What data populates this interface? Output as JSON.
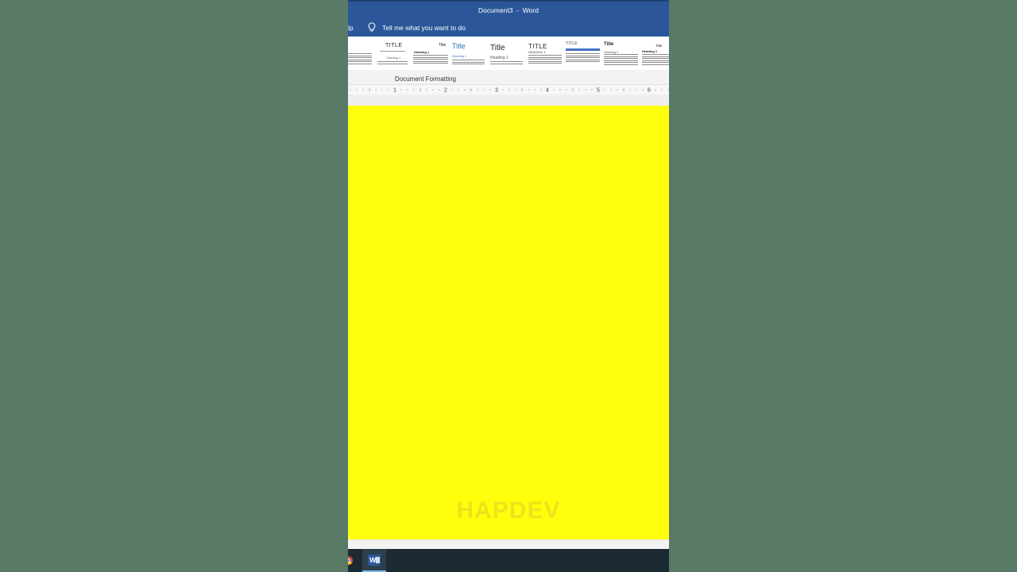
{
  "window": {
    "title": "Document3  -  Word"
  },
  "tell_bar": {
    "help_tab": "lp",
    "search_label": "Tell me what you want to do"
  },
  "ribbon": {
    "group_label": "Document Formatting",
    "gallery": [
      {
        "title": "",
        "heading": ""
      },
      {
        "title": "TITLE",
        "heading": "Heading 1"
      },
      {
        "title": "Title",
        "heading": "Heading 1"
      },
      {
        "title": "Title",
        "heading": "Heading 1"
      },
      {
        "title": "Title",
        "heading": "Heading 1"
      },
      {
        "title": "TITLE",
        "heading": "HEADING 1"
      },
      {
        "title": "TITLE",
        "heading": ""
      },
      {
        "title": "Title",
        "heading": "Heading 1"
      },
      {
        "title": "Title",
        "heading": "Heading 1"
      }
    ]
  },
  "ruler": {
    "numbers": [
      "1",
      "2",
      "3",
      "4",
      "5",
      "6"
    ]
  },
  "document": {
    "watermark": "HAPDEV"
  },
  "taskbar": {
    "apps": [
      "chrome-icon",
      "word-icon"
    ]
  },
  "colors": {
    "title_bar": "#2b579a",
    "page": "#ffff0c",
    "backdrop": "#587a66"
  }
}
